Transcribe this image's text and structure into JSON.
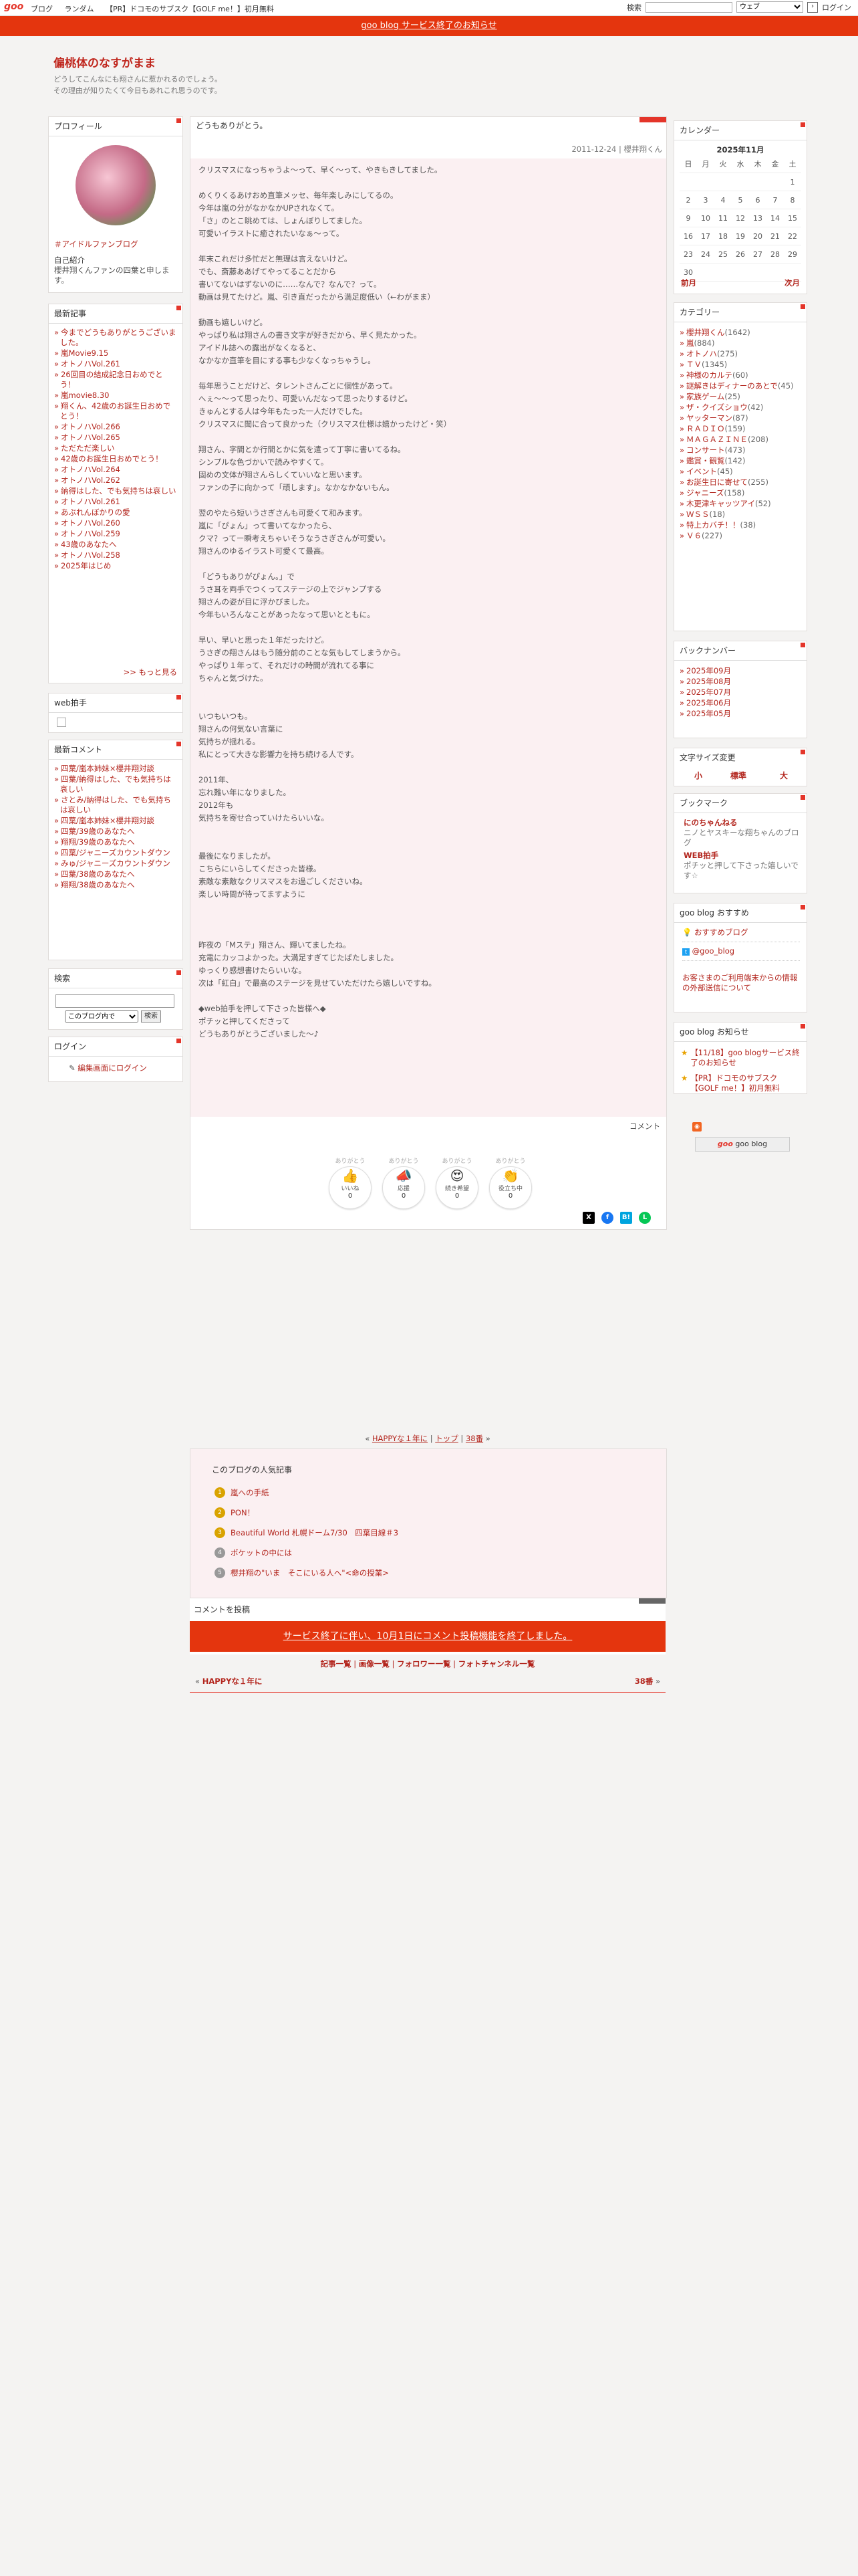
{
  "topbar": {
    "logo": "goo",
    "nav": [
      "ブログ",
      "ランダム",
      "【PR】ドコモのサブスク【GOLF me！】初月無料"
    ],
    "search_label": "検索",
    "search_scope": "ウェブ",
    "search_go": "›",
    "login": "ログイン"
  },
  "notice": "goo blog サービス終了のお知らせ",
  "blog": {
    "title": "偏桃体のなすがまま",
    "desc_line1": "どうしてこんなにも翔さんに惹かれるのでしょう。",
    "desc_line2": "その理由が知りたくて今日もあれこれ思うのです。"
  },
  "profile": {
    "heading": "プロフィール",
    "link": "＃アイドルファンブログ",
    "intro_label": "自己紹介",
    "intro_text": "櫻井翔くんファンの四葉と申します。"
  },
  "recent_posts": {
    "heading": "最新記事",
    "items": [
      "今までどうもありがとうございました。",
      "嵐Movie9.15",
      "オトノハVol.261",
      "26回目の結成記念日おめでとう！",
      "嵐movie8.30",
      "翔くん、42歳のお誕生日おめでとう！",
      "オトノハVol.266",
      "オトノハVol.265",
      "ただただ楽しい",
      "42歳のお誕生日おめでとう！",
      "オトノハVol.264",
      "オトノハVol.262",
      "納得はした、でも気持ちは哀しい",
      "オトノハVol.261",
      "あぶれんぼかりの愛",
      "オトノハVol.260",
      "オトノハVol.259",
      "43歳のあなたへ",
      "オトノハVol.258",
      "2025年はじめ"
    ],
    "more": ">> もっと見る"
  },
  "webclap": {
    "heading": "web拍手"
  },
  "recent_comments": {
    "heading": "最新コメント",
    "items": [
      "四葉/嵐本姉妹×櫻井翔対談",
      "四葉/納得はした、でも気持ちは哀しい",
      "さとみ/納得はした、でも気持ちは哀しい",
      "四葉/嵐本姉妹×櫻井翔対談",
      "四葉/39歳のあなたへ",
      "翔翔/39歳のあなたへ",
      "四葉/ジャニーズカウントダウン",
      "みゅ/ジャニーズカウントダウン",
      "四葉/38歳のあなたへ",
      "翔翔/38歳のあなたへ"
    ]
  },
  "search": {
    "heading": "検索",
    "scope": "このブログ内で",
    "button": "検索"
  },
  "login_box": {
    "heading": "ログイン",
    "link": "編集画面にログイン"
  },
  "post": {
    "title": "どうもありがとう。",
    "meta": "2011-12-24 | 櫻井翔くん",
    "lines": [
      "クリスマスになっちゃうよ～って、早く～って、やきもきしてました。",
      "",
      "めくりくるあけおめ直筆メッセ、毎年楽しみにしてるの。",
      "今年は嵐の分がなかなかUPされなくて。",
      "「さ」のとこ眺めては、しょんぼりしてました。",
      "可愛いイラストに癒されたいなぁ～って。",
      "",
      "年末これだけ多忙だと無理は言えないけど。",
      "でも、斎藤ああげてやってることだから",
      "書いてないはずないのに……なんで？なんで？って。",
      "動画は見てたけど。嵐、引き直だったから満足度低い（←わがまま）",
      "",
      "動画も嬉しいけど。",
      "やっぱり私は翔さんの書き文字が好きだから、早く見たかった。",
      "アイドル誌への露出がなくなると、",
      "なかなか直筆を目にする事も少なくなっちゃうし。",
      "",
      "毎年思うことだけど、タレントさんごとに個性があって。",
      "へぇ～～って思ったり、可愛いんだなって思ったりするけど。",
      "きゅんとする人は今年もたった一人だけでした。",
      "クリスマスに聞に合って良かった（クリスマス仕様は嬉かったけど・笑）",
      "",
      "翔さん、字間とか行間とかに気を遣って丁寧に書いてるね。",
      "シンプルな色づかいで読みやすくて。",
      "固めの文体が翔さんらしくていいなと思います。",
      "ファンの子に向かって「頑します」。なかなかないもん。",
      "",
      "翌のやたら短いうさぎさんも可愛くて和みます。",
      "嵐に「ぴょん」って書いてなかったら、",
      "クマ？ってー瞬考えちゃいそうなうさぎさんが可愛い。",
      "翔さんのゆるイラスト可愛くて最高。",
      "",
      "「どうもありがぴょん。」で",
      "うさ耳を両手でつくってステージの上でジャンプする",
      "翔さんの姿が目に浮かびました。",
      "今年もいろんなことがあったなって思いとともに。",
      "",
      "早い、早いと思った１年だったけど。",
      "うさぎの翔さんはもう随分前のことな気もしてしまうから。",
      "やっぱり１年って、それだけの時間が流れてる事に",
      "ちゃんと気づけた。",
      "",
      "",
      "いつもいつも。",
      "翔さんの何気ない言葉に",
      "気持ちが揺れる。",
      "私にとって大きな影響力を持ち続ける人です。",
      "",
      "2011年、",
      "忘れ難い年になりました。",
      "2012年も",
      "気持ちを寄せ合っていけたらいいな。",
      "",
      "",
      "最後になりましたが。",
      "こちらにいらしてくださった皆様。",
      "素敵な素敵なクリスマスをお過ごしくださいね。",
      "楽しい時間が待ってますように",
      "",
      "",
      "",
      "昨夜の「Mステ」翔さん、輝いてましたね。",
      "充電にカッコよかった。大満足すぎてじたばたしました。",
      "ゆっくり感想書けたらいいな。",
      "次は「紅白」で最高のステージを見せていただけたら嬉しいですね。",
      "",
      "◆web拍手を押して下さった皆様へ◆",
      "ポチッと押してくださって",
      "どうもありがとうございました～♪"
    ],
    "comment_label": "コメント"
  },
  "reactions": [
    {
      "label": "ありがとう",
      "icon": "thumbs-up-icon",
      "glyph": "👍",
      "name": "いいね",
      "count": "0"
    },
    {
      "label": "ありがとう",
      "icon": "cheer-icon",
      "glyph": "📣",
      "name": "応援",
      "count": "0"
    },
    {
      "label": "ありがとう",
      "icon": "heart-eyes-icon",
      "glyph": "😍",
      "name": "続き希望",
      "count": "0"
    },
    {
      "label": "ありがとう",
      "icon": "clap-icon",
      "glyph": "👏",
      "name": "役立ち中",
      "count": "0"
    }
  ],
  "pager": {
    "prev": "HAPPYな１年に",
    "top": "トップ",
    "next": "38番"
  },
  "popular": {
    "heading": "このブログの人気記事",
    "items": [
      {
        "rank": "1",
        "text": "嵐への手紙"
      },
      {
        "rank": "2",
        "text": "PON！"
      },
      {
        "rank": "3",
        "text": "Beautiful World 札幌ドーム7/30　四葉目線＃3"
      },
      {
        "rank": "4",
        "text": "ポケットの中には"
      },
      {
        "rank": "5",
        "text": "櫻井翔の\"いま　そこにいる人へ\"<命の授業>"
      }
    ]
  },
  "comment_post": {
    "heading": "コメントを投稿",
    "notice": "サービス終了に伴い、10月1日にコメント投稿機能を終了しました。"
  },
  "footer_links": [
    "記事一覧",
    "画像一覧",
    "フォロワー一覧",
    "フォトチャンネル一覧"
  ],
  "footer_pager": {
    "prev": "HAPPYな１年に",
    "next": "38番"
  },
  "calendar": {
    "heading": "カレンダー",
    "month": "2025年11月",
    "days": [
      "日",
      "月",
      "火",
      "水",
      "木",
      "金",
      "土"
    ],
    "weeks": [
      [
        "",
        "",
        "",
        "",
        "",
        "",
        "1"
      ],
      [
        "2",
        "3",
        "4",
        "5",
        "6",
        "7",
        "8"
      ],
      [
        "9",
        "10",
        "11",
        "12",
        "13",
        "14",
        "15"
      ],
      [
        "16",
        "17",
        "18",
        "19",
        "20",
        "21",
        "22"
      ],
      [
        "23",
        "24",
        "25",
        "26",
        "27",
        "28",
        "29"
      ],
      [
        "30",
        "",
        "",
        "",
        "",
        "",
        ""
      ]
    ],
    "prev": "前月",
    "next": "次月"
  },
  "categories": {
    "heading": "カテゴリー",
    "items": [
      {
        "name": "櫻井翔くん",
        "count": "(1642)"
      },
      {
        "name": "嵐",
        "count": "(884)"
      },
      {
        "name": "オトノハ",
        "count": "(275)"
      },
      {
        "name": "ＴＶ",
        "count": "(1345)"
      },
      {
        "name": "神様のカルテ",
        "count": "(60)"
      },
      {
        "name": "謎解きはディナーのあとで",
        "count": "(45)"
      },
      {
        "name": "家族ゲーム",
        "count": "(25)"
      },
      {
        "name": "ザ・クイズショウ",
        "count": "(42)"
      },
      {
        "name": "ヤッターマン",
        "count": "(87)"
      },
      {
        "name": "ＲＡＤＩＯ",
        "count": "(159)"
      },
      {
        "name": "ＭＡＧＡＺＩＮＥ",
        "count": "(208)"
      },
      {
        "name": "コンサート",
        "count": "(473)"
      },
      {
        "name": "鑑賞・観覧",
        "count": "(142)"
      },
      {
        "name": "イベント",
        "count": "(45)"
      },
      {
        "name": "お誕生日に寄せて",
        "count": "(255)"
      },
      {
        "name": "ジャニーズ",
        "count": "(158)"
      },
      {
        "name": "木更津キャッツアイ",
        "count": "(52)"
      },
      {
        "name": "ＷＳＳ",
        "count": "(18)"
      },
      {
        "name": "特上カバチ！！",
        "count": "(38)"
      },
      {
        "name": "Ｖ６",
        "count": "(227)"
      }
    ]
  },
  "backnumber": {
    "heading": "バックナンバー",
    "items": [
      "2025年09月",
      "2025年08月",
      "2025年07月",
      "2025年06月",
      "2025年05月"
    ]
  },
  "fontsize": {
    "heading": "文字サイズ変更",
    "small": "小",
    "mid": "標準",
    "large": "大"
  },
  "bookmark": {
    "heading": "ブックマーク",
    "items": [
      {
        "name": "にのちゃんねる",
        "desc": "ニノとヤスキーな翔ちゃんのブログ"
      },
      {
        "name": "WEB拍手",
        "desc": "ポチッと押して下さった嬉しいです☆"
      }
    ]
  },
  "goo_recommend": {
    "heading": "goo blog おすすめ",
    "recommend": "おすすめブログ",
    "twitter": "@goo_blog",
    "notice": "お客さまのご利用端末からの情報の外部送信について"
  },
  "goo_news": {
    "heading": "goo blog お知らせ",
    "items": [
      "【11/18】goo blogサービス終了のお知らせ",
      "【PR】ドコモのサブスク【GOLF me！】初月無料"
    ]
  },
  "rss": "RSS",
  "goo_blog_badge": "goo blog",
  "colors": {
    "accent": "#e4352a",
    "notice_bg": "#e4350e",
    "link": "#b3261e",
    "pink_bg": "#fbf0f2"
  }
}
